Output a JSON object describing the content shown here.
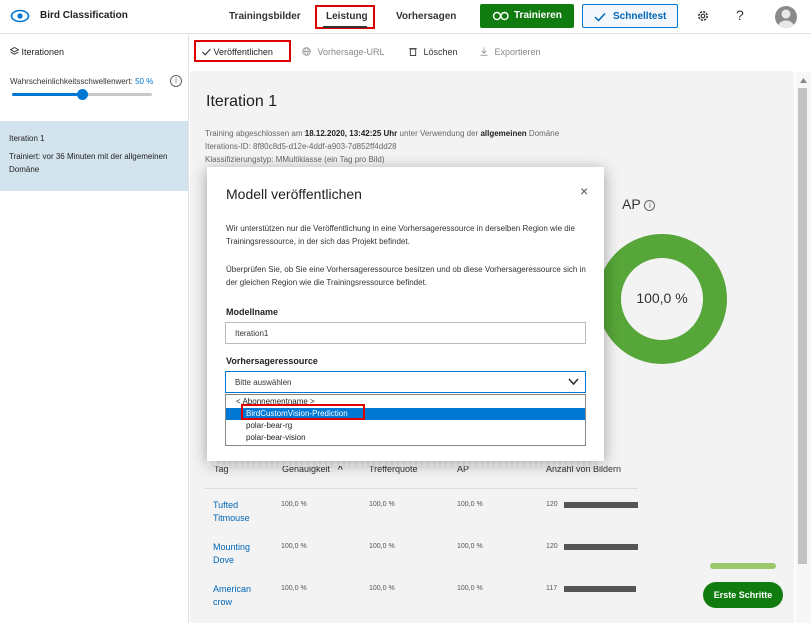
{
  "app": {
    "title": "Bird Classification"
  },
  "nav": {
    "training": "Trainingsbilder",
    "performance": "Leistung",
    "predictions": "Vorhersagen"
  },
  "header": {
    "train_label": "Trainieren",
    "quicktest_label": "Schnelltest",
    "help_glyph": "?"
  },
  "sidebar": {
    "heading": "Iterationen",
    "threshold_label": "Wahrscheinlichkeitsschwellenwert:",
    "threshold_value": "50 %",
    "threshold_fraction": 0.5,
    "iteration_title": "Iteration 1",
    "iteration_desc": "Trainiert: vor 36 Minuten mit der allgemeinen Domäne"
  },
  "toolbar": {
    "publish": "Veröffentlichen",
    "prediction_url": "Vorhersage-URL",
    "delete": "Löschen",
    "export": "Exportieren"
  },
  "main": {
    "title": "Iteration 1",
    "meta1_pre": "Training abgeschlossen am ",
    "meta1_date": "18.12.2020, 13:42:25 Uhr",
    "meta1_mid": " unter Verwendung der ",
    "meta1_domain": "allgemeinen",
    "meta1_post": " Domäne",
    "meta2": "Iterations-ID: 8f80c8d5-d12e-4ddf-a903-7d852ff4dd28",
    "meta3": "Klassifizierungstyp: MMultiklasse (ein Tag pro Bild)",
    "ap_label": "AP",
    "ap_value": "100,0 %",
    "ap_fraction": 1.0
  },
  "table": {
    "headers": [
      "Tag",
      "Genauigkeit",
      "Trefferquote",
      "AP",
      "Anzahl von Bildern"
    ],
    "sort_glyph": "^",
    "rows": [
      {
        "tag": "Tufted Titmouse",
        "precision": "100,0 %",
        "recall": "100,0 %",
        "ap": "100,0 %",
        "count": "120",
        "count_value": 120
      },
      {
        "tag": "Mounting Dove",
        "precision": "100,0 %",
        "recall": "100,0 %",
        "ap": "100,0 %",
        "count": "120",
        "count_value": 120
      },
      {
        "tag": "American crow",
        "precision": "100,0 %",
        "recall": "100,0 %",
        "ap": "100,0 %",
        "count": "117",
        "count_value": 117
      }
    ]
  },
  "get_started": "Erste Schritte",
  "dialog": {
    "title": "Modell veröffentlichen",
    "close_glyph": "×",
    "para1": "Wir unterstützen nur die Veröffentlichung in eine Vorhersageressource in derselben Region wie die Trainingsressource, in der sich das Projekt befindet.",
    "para2": "Überprüfen Sie, ob Sie eine Vorhersageressource besitzen und ob diese Vorhersageressource sich in der gleichen Region wie die Trainingsressource befindet.",
    "model_name_label": "Modellname",
    "model_name_value": "Iteration1",
    "resource_label": "Vorhersageressource",
    "resource_placeholder": "Bitte auswählen",
    "options": [
      "< Abonnementname >",
      "BirdCustomVision-Prediction",
      "polar-bear-rg",
      "polar-bear-vision"
    ]
  },
  "colors": {
    "accent": "#0078d4",
    "green": "#107c10",
    "donut": "#57a639",
    "highlight_box": "#dd0000"
  }
}
